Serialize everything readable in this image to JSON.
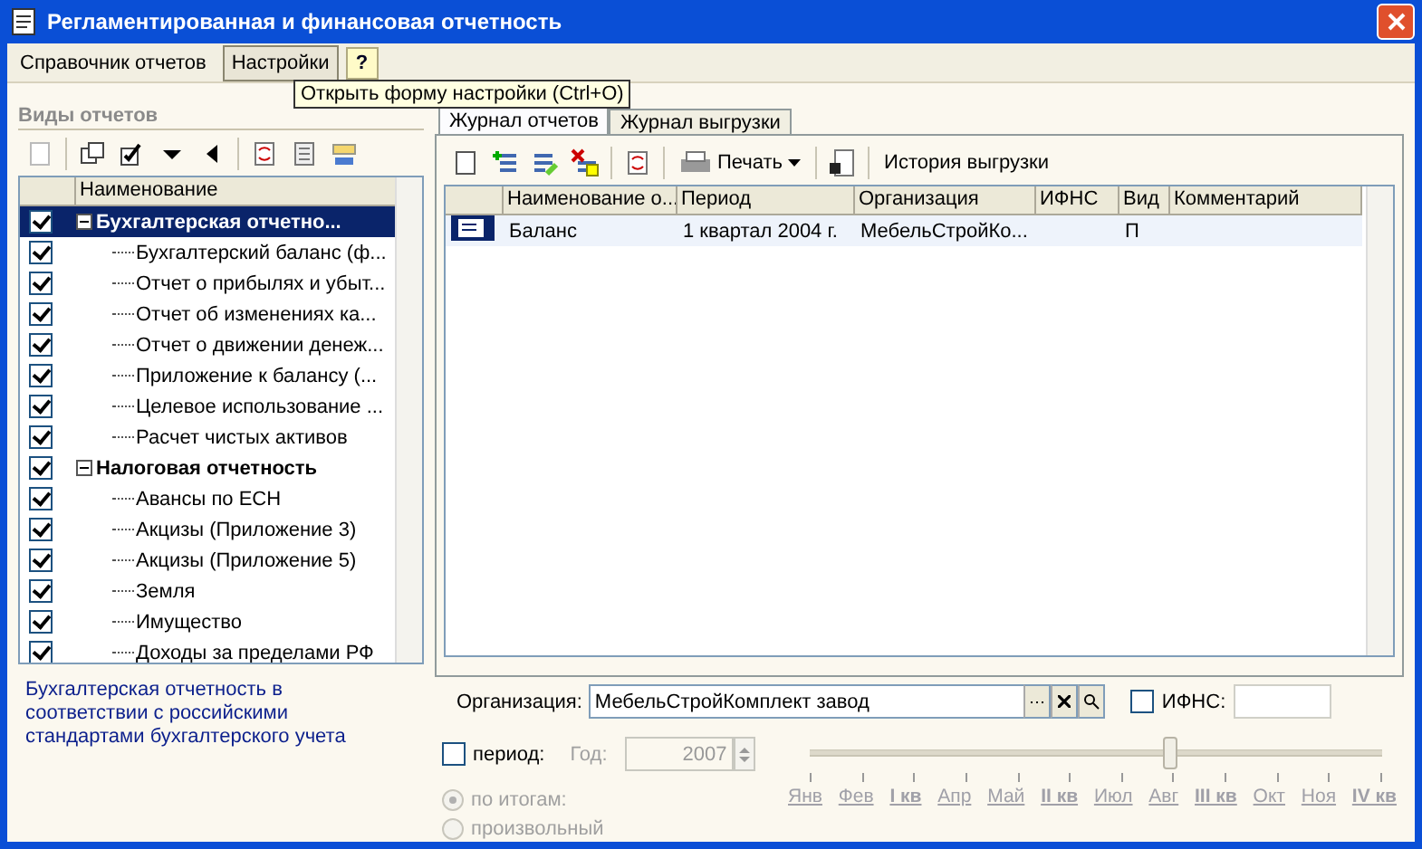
{
  "window": {
    "title": "Регламентированная и финансовая отчетность"
  },
  "menu": [
    {
      "label": "Справочник отчетов",
      "selected": false
    },
    {
      "label": "Настройки",
      "selected": true
    }
  ],
  "help_button": "?",
  "tooltip": "Открыть форму настройки (Ctrl+O)",
  "left": {
    "title": "Виды отчетов",
    "column": "Наименование",
    "tree": [
      {
        "label": "Бухгалтерская отчетно...",
        "checked": true,
        "selected": true,
        "expanded": true,
        "children": [
          {
            "label": "Бухгалтерский баланс (ф...",
            "checked": true,
            "selected": false
          },
          {
            "label": "Отчет о прибылях и убыт...",
            "checked": true,
            "selected": false
          },
          {
            "label": "Отчет об изменениях ка...",
            "checked": true,
            "selected": false
          },
          {
            "label": "Отчет о движении денеж...",
            "checked": true,
            "selected": false
          },
          {
            "label": "Приложение к балансу (...",
            "checked": true,
            "selected": false
          },
          {
            "label": "Целевое использование ...",
            "checked": true,
            "selected": false
          },
          {
            "label": "Расчет чистых активов",
            "checked": true,
            "selected": false
          }
        ]
      },
      {
        "label": "Налоговая отчетность",
        "checked": true,
        "selected": false,
        "expanded": true,
        "children": [
          {
            "label": "Авансы по ЕСН",
            "checked": true,
            "selected": false
          },
          {
            "label": "Акцизы (Приложение 3)",
            "checked": true,
            "selected": false
          },
          {
            "label": "Акцизы (Приложение 5)",
            "checked": true,
            "selected": false
          },
          {
            "label": "Земля",
            "checked": true,
            "selected": false
          },
          {
            "label": "Имущество",
            "checked": true,
            "selected": false
          },
          {
            "label": "Доходы за пределами РФ",
            "checked": true,
            "selected": false
          }
        ]
      }
    ],
    "description": "Бухгалтерская отчетность в соответствии с российскими стандартами бухгалтерского учета"
  },
  "tabs": [
    {
      "label": "Журнал отчетов",
      "selected": true
    },
    {
      "label": "Журнал выгрузки",
      "selected": false
    }
  ],
  "toolbar": {
    "print": "Печать",
    "history": "История выгрузки"
  },
  "table": {
    "columns": [
      "Наименование о...",
      "Период",
      "Организация",
      "ИФНС",
      "Вид",
      "Комментарий"
    ],
    "rows": [
      {
        "cells": [
          "Баланс",
          "1 квартал 2004 г.",
          "МебельСтройКо...",
          "",
          "П",
          ""
        ],
        "selected": true
      }
    ]
  },
  "filters": {
    "organization": {
      "label": "Организация:",
      "value": "МебельСтройКомплект завод"
    },
    "ifns": {
      "label": "ИФНС:",
      "checked": false
    },
    "period": {
      "label": "период:",
      "checked": false
    },
    "year": {
      "label": "Год:",
      "value": "2007"
    },
    "radios": [
      {
        "label": "по итогам:",
        "selected": true
      },
      {
        "label": "произвольный",
        "selected": false
      }
    ],
    "slider": {
      "level": 0.63
    },
    "months": [
      {
        "label": "Янв",
        "kind": "month"
      },
      {
        "label": "Фев",
        "kind": "month"
      },
      {
        "label": "I кв",
        "kind": "quarter"
      },
      {
        "label": "Апр",
        "kind": "month"
      },
      {
        "label": "Май",
        "kind": "month"
      },
      {
        "label": "II кв",
        "kind": "quarter"
      },
      {
        "label": "Июл",
        "kind": "month"
      },
      {
        "label": "Авг",
        "kind": "month"
      },
      {
        "label": "III кв",
        "kind": "quarter"
      },
      {
        "label": "Окт",
        "kind": "month"
      },
      {
        "label": "Ноя",
        "kind": "month"
      },
      {
        "label": "IV кв",
        "kind": "quarter"
      }
    ]
  }
}
